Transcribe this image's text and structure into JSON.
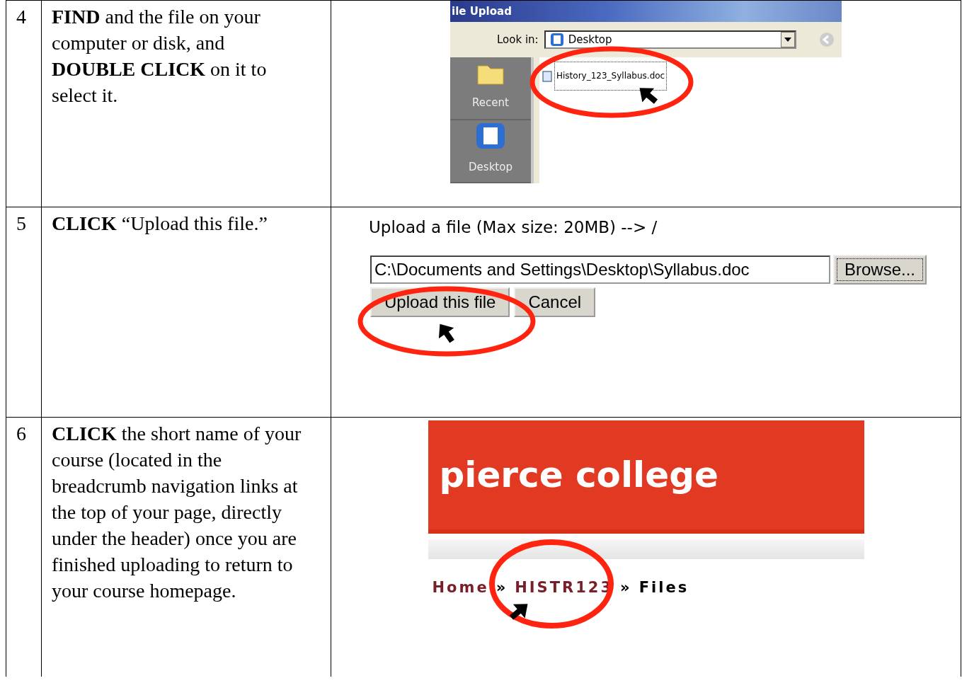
{
  "steps": [
    {
      "number": "4",
      "instruction": "**FIND** and the file on your computer or disk, and **DOUBLE CLICK** on it to select it.",
      "screenshot": {
        "kind": "file_dialog",
        "title": "ile Upload",
        "look_in_label": "Look in:",
        "look_in_value": "Desktop",
        "places": [
          "Recent",
          "Desktop"
        ],
        "file": "History_123_Syllabus.doc"
      }
    },
    {
      "number": "5",
      "instruction": "**CLICK** “Upload this file.”",
      "screenshot": {
        "kind": "upload_form",
        "label": "Upload a file (Max size: 20MB) --> /",
        "path": "C:\\Documents and Settings\\Desktop\\Syllabus.doc",
        "browse": "Browse...",
        "buttons": [
          "Upload this file",
          "Cancel"
        ]
      }
    },
    {
      "number": "6",
      "instruction": "**CLICK** the short name of your course (located in the breadcrumb navigation links at the top of your page, directly under the header) once you are finished uploading to return to your course homepage.",
      "screenshot": {
        "kind": "course_header",
        "logo": "pierce college",
        "breadcrumb": [
          {
            "text": "Home",
            "kind": "link"
          },
          {
            "text": "»",
            "kind": "separator"
          },
          {
            "text": "HISTR123",
            "kind": "link"
          },
          {
            "text": "»",
            "kind": "separator"
          },
          {
            "text": "Files",
            "kind": "current"
          }
        ]
      }
    }
  ]
}
